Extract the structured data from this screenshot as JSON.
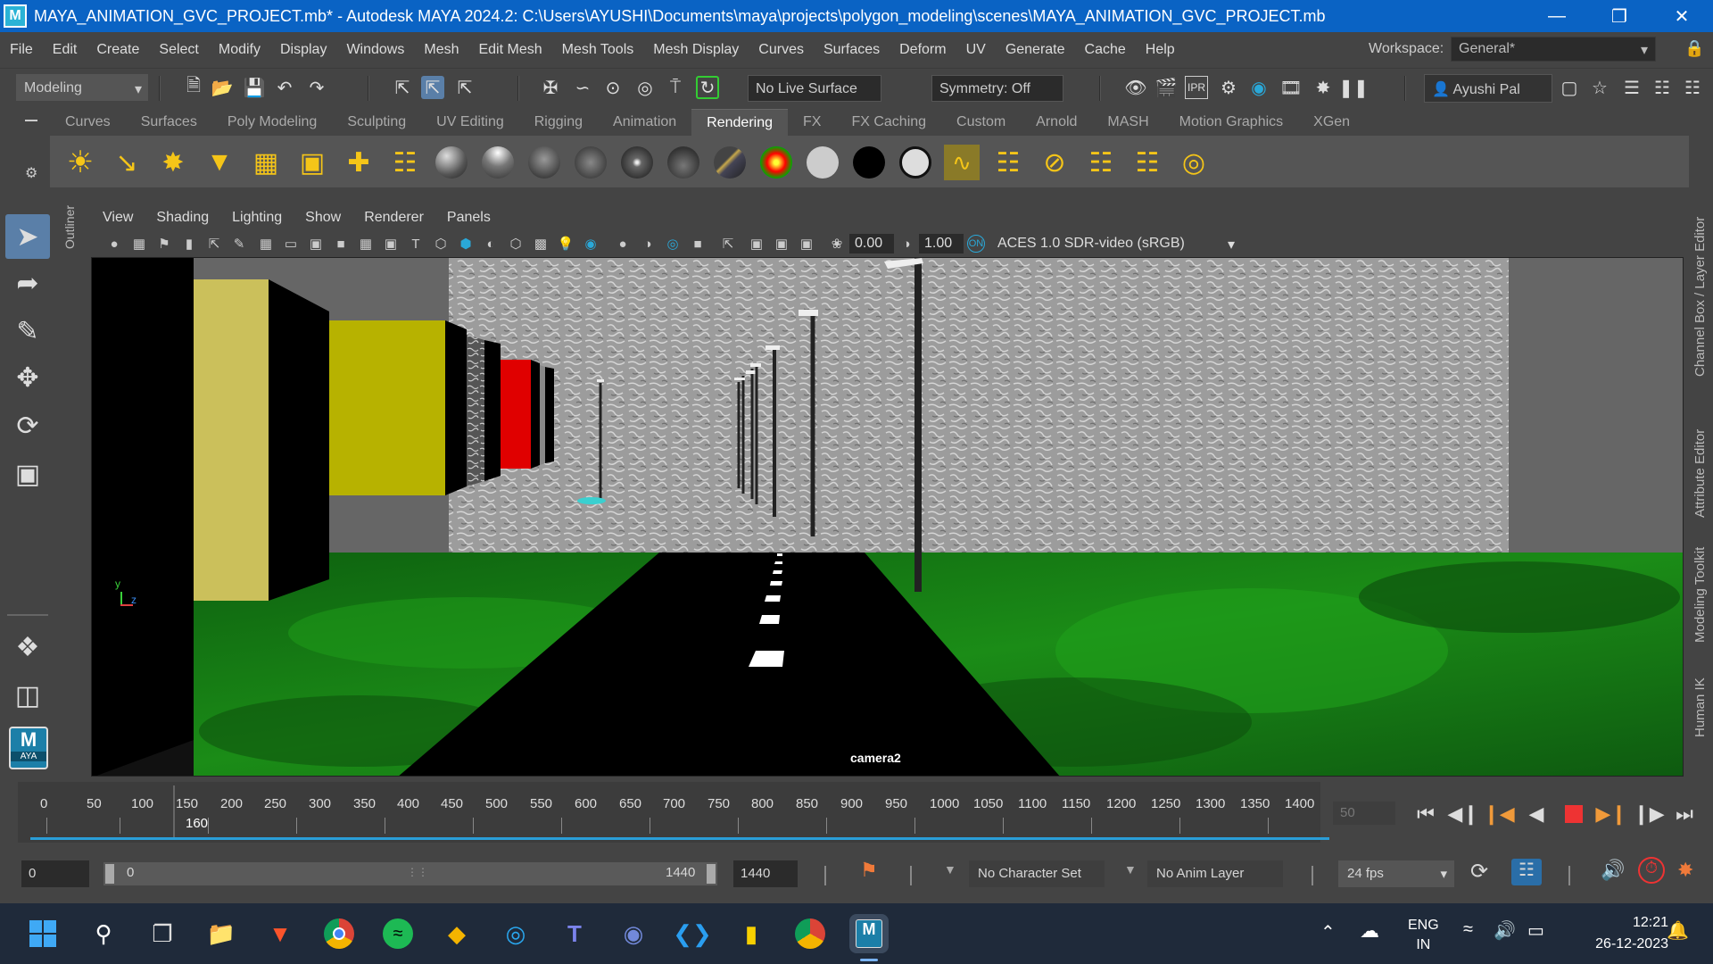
{
  "window": {
    "logo": "M",
    "title": "MAYA_ANIMATION_GVC_PROJECT.mb* - Autodesk MAYA 2024.2: C:\\Users\\AYUSHI\\Documents\\maya\\projects\\polygon_modeling\\scenes\\MAYA_ANIMATION_GVC_PROJECT.mb",
    "controls": [
      "minimize-icon",
      "restore-icon",
      "close-icon"
    ]
  },
  "menubar": {
    "items": [
      "File",
      "Edit",
      "Create",
      "Select",
      "Modify",
      "Display",
      "Windows",
      "Mesh",
      "Edit Mesh",
      "Mesh Tools",
      "Mesh Display",
      "Curves",
      "Surfaces",
      "Deform",
      "UV",
      "Generate",
      "Cache",
      "Help"
    ],
    "workspace_label": "Workspace:",
    "workspace_value": "General*"
  },
  "statusline": {
    "menuset": "Modeling",
    "live_surface": "No Live Surface",
    "symmetry": "Symmetry: Off",
    "user": "Ayushi Pal"
  },
  "shelf": {
    "tabs": [
      "Curves",
      "Surfaces",
      "Poly Modeling",
      "Sculpting",
      "UV Editing",
      "Rigging",
      "Animation",
      "Rendering",
      "FX",
      "FX Caching",
      "Custom",
      "Arnold",
      "MASH",
      "Motion Graphics",
      "XGen"
    ],
    "active_tab": "Rendering"
  },
  "side": {
    "outliner_label": "Outliner",
    "maya_badge_letter": "M",
    "maya_badge_text": "AYA",
    "right_tabs": [
      "Channel Box / Layer Editor",
      "Attribute Editor",
      "Modeling Toolkit",
      "Human IK"
    ]
  },
  "panel": {
    "menus": [
      "View",
      "Shading",
      "Lighting",
      "Show",
      "Renderer",
      "Panels"
    ],
    "exposure": "0.00",
    "gamma": "1.00",
    "colorspace": "ACES 1.0 SDR-video (sRGB)",
    "camera_label": "camera2",
    "axis_y": "y",
    "axis_z": "z"
  },
  "timeline": {
    "ticks": [
      "0",
      "50",
      "100",
      "150",
      "200",
      "250",
      "300",
      "350",
      "400",
      "450",
      "500",
      "550",
      "600",
      "650",
      "700",
      "750",
      "800",
      "850",
      "900",
      "950",
      "1000",
      "1050",
      "1100",
      "1150",
      "1200",
      "1250",
      "1300",
      "1350",
      "1400"
    ],
    "current_frame": "160",
    "frame_field": "50"
  },
  "range": {
    "start": "0",
    "range_start": "0",
    "range_end": "1440",
    "end": "1440",
    "character_set": "No Character Set",
    "anim_layer": "No Anim Layer",
    "fps": "24 fps"
  },
  "taskbar": {
    "lang1": "ENG",
    "lang2": "IN",
    "time": "12:21",
    "date": "26-12-2023"
  }
}
